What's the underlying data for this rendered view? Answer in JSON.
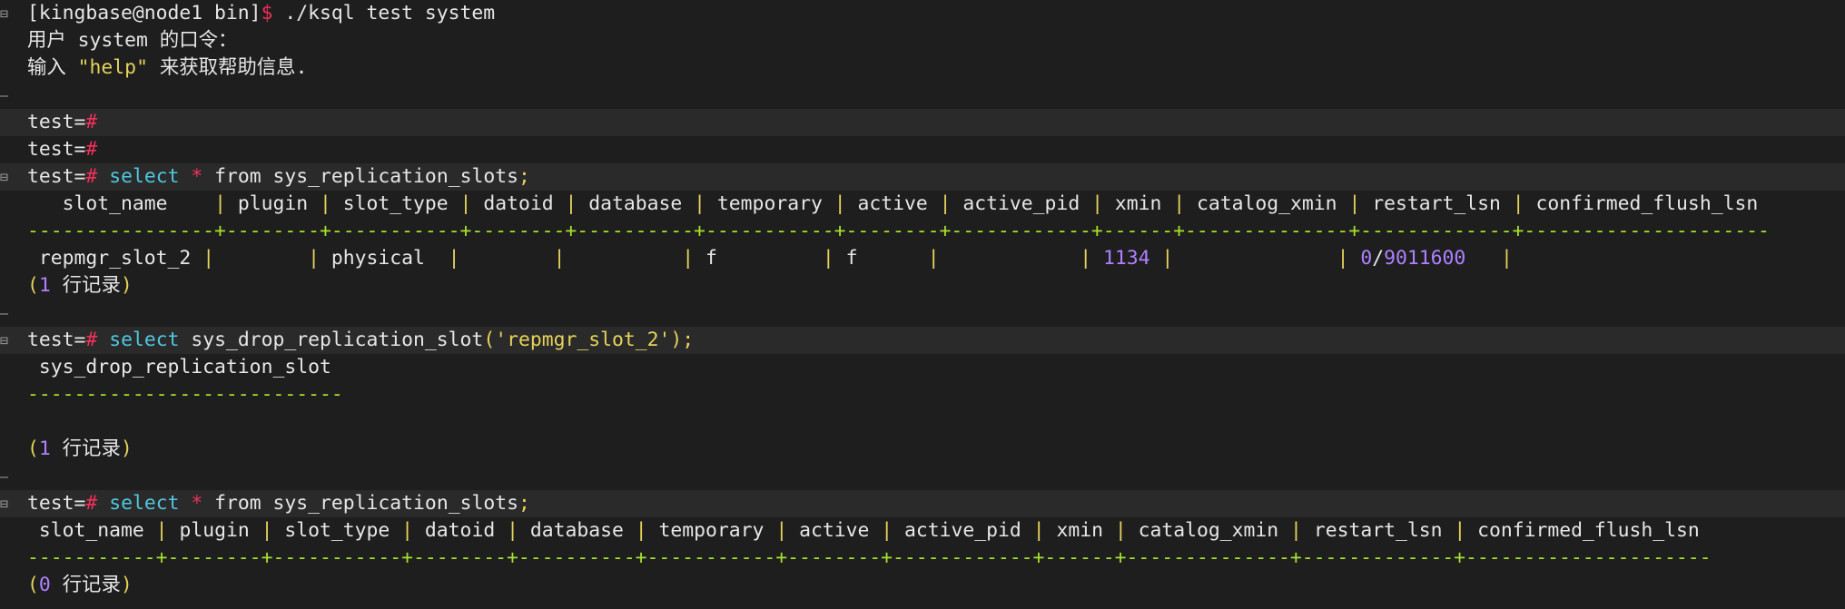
{
  "lines": [
    {
      "hl": false,
      "fold": "minus",
      "segs": [
        {
          "t": "[kingbase@node1 bin]",
          "c": "def"
        },
        {
          "t": "$",
          "c": "red"
        },
        {
          "t": " ./ksql test system",
          "c": "def"
        }
      ]
    },
    {
      "hl": false,
      "fold": "",
      "segs": [
        {
          "t": "用户 system 的口令：",
          "c": "def"
        }
      ]
    },
    {
      "hl": false,
      "fold": "",
      "segs": [
        {
          "t": "输入 ",
          "c": "def"
        },
        {
          "t": "\"help\"",
          "c": "yel"
        },
        {
          "t": " 来获取帮助信息.",
          "c": "def"
        }
      ]
    },
    {
      "hl": false,
      "fold": "dash",
      "segs": []
    },
    {
      "hl": true,
      "fold": "",
      "segs": [
        {
          "t": "test=",
          "c": "def"
        },
        {
          "t": "#",
          "c": "red"
        }
      ]
    },
    {
      "hl": false,
      "fold": "",
      "segs": [
        {
          "t": "test=",
          "c": "def"
        },
        {
          "t": "#",
          "c": "red"
        }
      ]
    },
    {
      "hl": true,
      "fold": "minus",
      "segs": [
        {
          "t": "test=",
          "c": "def"
        },
        {
          "t": "#",
          "c": "red"
        },
        {
          "t": " ",
          "c": "def"
        },
        {
          "t": "select",
          "c": "cya"
        },
        {
          "t": " ",
          "c": "def"
        },
        {
          "t": "*",
          "c": "red"
        },
        {
          "t": " from sys_replication_slots",
          "c": "def"
        },
        {
          "t": ";",
          "c": "yel"
        }
      ]
    },
    {
      "hl": false,
      "fold": "",
      "segs": [
        {
          "t": "   slot_name    ",
          "c": "def"
        },
        {
          "t": "|",
          "c": "yel"
        },
        {
          "t": " plugin ",
          "c": "def"
        },
        {
          "t": "|",
          "c": "yel"
        },
        {
          "t": " slot_type ",
          "c": "def"
        },
        {
          "t": "|",
          "c": "yel"
        },
        {
          "t": " datoid ",
          "c": "def"
        },
        {
          "t": "|",
          "c": "yel"
        },
        {
          "t": " database ",
          "c": "def"
        },
        {
          "t": "|",
          "c": "yel"
        },
        {
          "t": " temporary ",
          "c": "def"
        },
        {
          "t": "|",
          "c": "yel"
        },
        {
          "t": " active ",
          "c": "def"
        },
        {
          "t": "|",
          "c": "yel"
        },
        {
          "t": " active_pid ",
          "c": "def"
        },
        {
          "t": "|",
          "c": "yel"
        },
        {
          "t": " xmin ",
          "c": "def"
        },
        {
          "t": "|",
          "c": "yel"
        },
        {
          "t": " catalog_xmin ",
          "c": "def"
        },
        {
          "t": "|",
          "c": "yel"
        },
        {
          "t": " restart_lsn ",
          "c": "def"
        },
        {
          "t": "|",
          "c": "yel"
        },
        {
          "t": " confirmed_flush_lsn",
          "c": "def"
        }
      ]
    },
    {
      "hl": false,
      "fold": "",
      "segs": [
        {
          "t": "----------------+--------+-----------+--------+----------+-----------+--------+------------+------+--------------+-------------+---------------------",
          "c": "dash"
        }
      ]
    },
    {
      "hl": false,
      "fold": "",
      "segs": [
        {
          "t": " repmgr_slot_2 ",
          "c": "def"
        },
        {
          "t": "|",
          "c": "yel"
        },
        {
          "t": "        ",
          "c": "def"
        },
        {
          "t": "|",
          "c": "yel"
        },
        {
          "t": " physical  ",
          "c": "def"
        },
        {
          "t": "|",
          "c": "yel"
        },
        {
          "t": "        ",
          "c": "def"
        },
        {
          "t": "|",
          "c": "yel"
        },
        {
          "t": "          ",
          "c": "def"
        },
        {
          "t": "|",
          "c": "yel"
        },
        {
          "t": " f         ",
          "c": "def"
        },
        {
          "t": "|",
          "c": "yel"
        },
        {
          "t": " f      ",
          "c": "def"
        },
        {
          "t": "|",
          "c": "yel"
        },
        {
          "t": "            ",
          "c": "def"
        },
        {
          "t": "|",
          "c": "yel"
        },
        {
          "t": " ",
          "c": "def"
        },
        {
          "t": "1134",
          "c": "pur"
        },
        {
          "t": " ",
          "c": "def"
        },
        {
          "t": "|",
          "c": "yel"
        },
        {
          "t": "              ",
          "c": "def"
        },
        {
          "t": "|",
          "c": "yel"
        },
        {
          "t": " ",
          "c": "def"
        },
        {
          "t": "0",
          "c": "pur"
        },
        {
          "t": "/",
          "c": "def"
        },
        {
          "t": "9011600",
          "c": "pur"
        },
        {
          "t": "   ",
          "c": "def"
        },
        {
          "t": "|",
          "c": "yel"
        }
      ]
    },
    {
      "hl": false,
      "fold": "",
      "segs": [
        {
          "t": "(",
          "c": "yel"
        },
        {
          "t": "1",
          "c": "pur"
        },
        {
          "t": " 行记录",
          "c": "def"
        },
        {
          "t": ")",
          "c": "yel"
        }
      ]
    },
    {
      "hl": false,
      "fold": "dash",
      "segs": []
    },
    {
      "hl": true,
      "fold": "minus",
      "segs": [
        {
          "t": "test=",
          "c": "def"
        },
        {
          "t": "#",
          "c": "red"
        },
        {
          "t": " ",
          "c": "def"
        },
        {
          "t": "select",
          "c": "cya"
        },
        {
          "t": " sys_drop_replication_slot",
          "c": "def"
        },
        {
          "t": "(",
          "c": "yel"
        },
        {
          "t": "'repmgr_slot_2'",
          "c": "yel"
        },
        {
          "t": ");",
          "c": "yel"
        }
      ]
    },
    {
      "hl": false,
      "fold": "",
      "segs": [
        {
          "t": " sys_drop_replication_slot",
          "c": "def"
        }
      ]
    },
    {
      "hl": false,
      "fold": "",
      "segs": [
        {
          "t": "---------------------------",
          "c": "dash"
        }
      ]
    },
    {
      "hl": false,
      "fold": "",
      "segs": []
    },
    {
      "hl": false,
      "fold": "",
      "segs": [
        {
          "t": "(",
          "c": "yel"
        },
        {
          "t": "1",
          "c": "pur"
        },
        {
          "t": " 行记录",
          "c": "def"
        },
        {
          "t": ")",
          "c": "yel"
        }
      ]
    },
    {
      "hl": false,
      "fold": "dash",
      "segs": []
    },
    {
      "hl": true,
      "fold": "minus",
      "segs": [
        {
          "t": "test=",
          "c": "def"
        },
        {
          "t": "#",
          "c": "red"
        },
        {
          "t": " ",
          "c": "def"
        },
        {
          "t": "select",
          "c": "cya"
        },
        {
          "t": " ",
          "c": "def"
        },
        {
          "t": "*",
          "c": "red"
        },
        {
          "t": " from sys_replication_slots",
          "c": "def"
        },
        {
          "t": ";",
          "c": "yel"
        }
      ]
    },
    {
      "hl": false,
      "fold": "",
      "segs": [
        {
          "t": " slot_name ",
          "c": "def"
        },
        {
          "t": "|",
          "c": "yel"
        },
        {
          "t": " plugin ",
          "c": "def"
        },
        {
          "t": "|",
          "c": "yel"
        },
        {
          "t": " slot_type ",
          "c": "def"
        },
        {
          "t": "|",
          "c": "yel"
        },
        {
          "t": " datoid ",
          "c": "def"
        },
        {
          "t": "|",
          "c": "yel"
        },
        {
          "t": " database ",
          "c": "def"
        },
        {
          "t": "|",
          "c": "yel"
        },
        {
          "t": " temporary ",
          "c": "def"
        },
        {
          "t": "|",
          "c": "yel"
        },
        {
          "t": " active ",
          "c": "def"
        },
        {
          "t": "|",
          "c": "yel"
        },
        {
          "t": " active_pid ",
          "c": "def"
        },
        {
          "t": "|",
          "c": "yel"
        },
        {
          "t": " xmin ",
          "c": "def"
        },
        {
          "t": "|",
          "c": "yel"
        },
        {
          "t": " catalog_xmin ",
          "c": "def"
        },
        {
          "t": "|",
          "c": "yel"
        },
        {
          "t": " restart_lsn ",
          "c": "def"
        },
        {
          "t": "|",
          "c": "yel"
        },
        {
          "t": " confirmed_flush_lsn",
          "c": "def"
        }
      ]
    },
    {
      "hl": false,
      "fold": "",
      "segs": [
        {
          "t": "-----------+--------+-----------+--------+----------+-----------+--------+------------+------+--------------+-------------+---------------------",
          "c": "dash"
        }
      ]
    },
    {
      "hl": false,
      "fold": "",
      "segs": [
        {
          "t": "(",
          "c": "yel"
        },
        {
          "t": "0",
          "c": "pur"
        },
        {
          "t": " 行记录",
          "c": "def"
        },
        {
          "t": ")",
          "c": "yel"
        }
      ]
    }
  ],
  "fold_icons": {
    "minus": "⊟",
    "dash": "–"
  }
}
